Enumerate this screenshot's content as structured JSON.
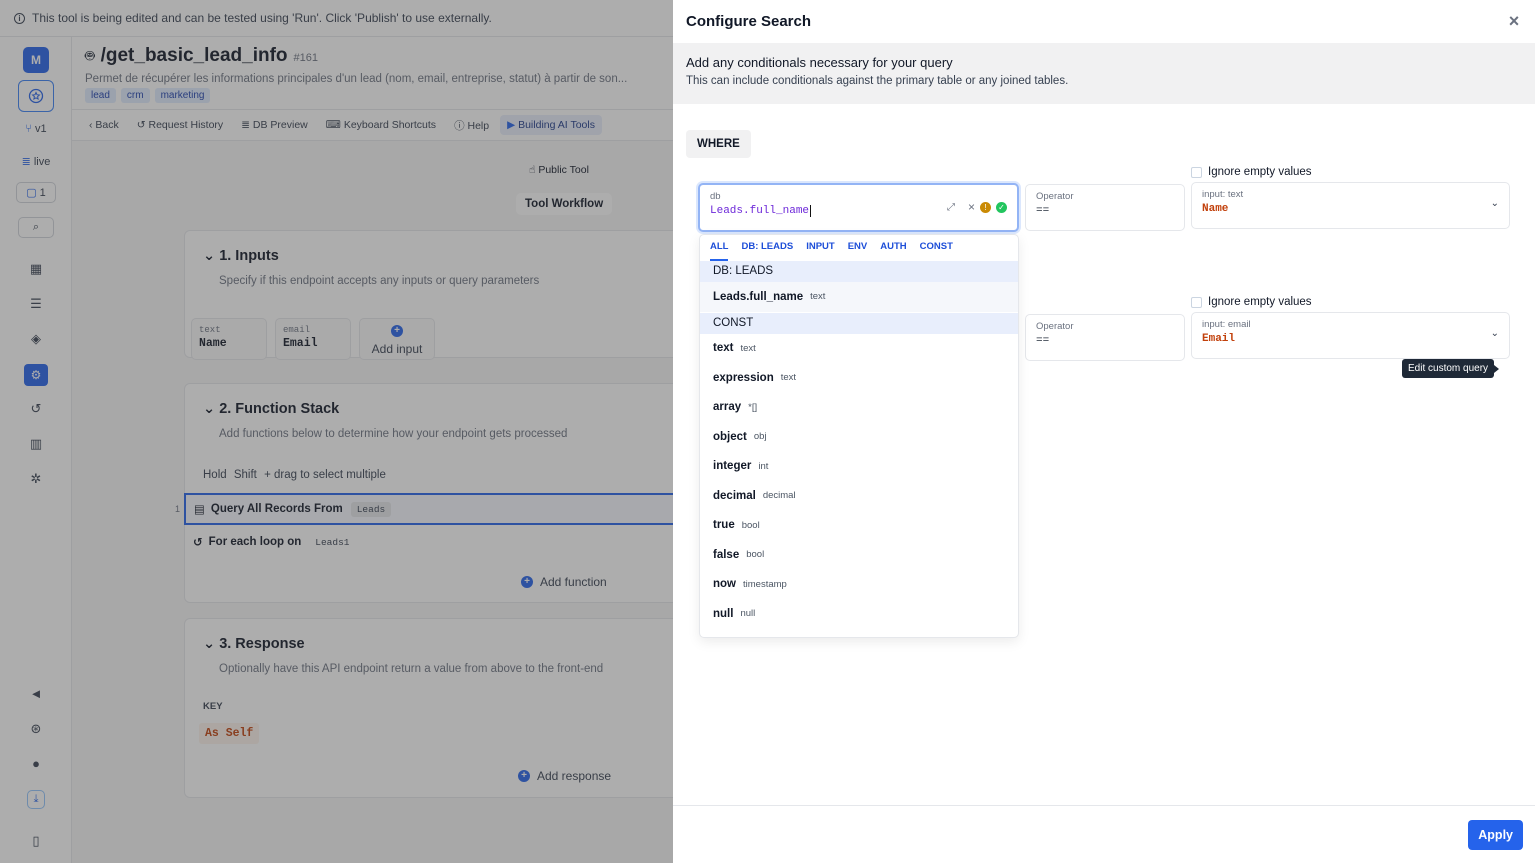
{
  "banner": {
    "text": "This tool is being edited and can be tested using 'Run'. Click 'Publish' to use externally."
  },
  "rail": {
    "avatar": "M",
    "version": "v1",
    "env": "live",
    "comments": "1"
  },
  "header": {
    "title": "/get_basic_lead_info",
    "number": "#161",
    "description": "Permet de récupérer les informations principales d'un lead (nom, email, entreprise, statut) à partir de son...",
    "tags": [
      "lead",
      "crm",
      "marketing"
    ]
  },
  "toolbar": {
    "back": "Back",
    "history": "Request History",
    "db_preview": "DB Preview",
    "shortcuts": "Keyboard Shortcuts",
    "help": "Help",
    "building": "Building AI Tools"
  },
  "canvas": {
    "public_tool": "Public Tool",
    "workflow": "Tool Workflow",
    "inputs": {
      "title": "1. Inputs",
      "subtitle": "Specify if this endpoint accepts any inputs or query parameters",
      "items": [
        {
          "type": "text",
          "name": "Name"
        },
        {
          "type": "email",
          "name": "Email"
        }
      ],
      "add": "Add input"
    },
    "function_stack": {
      "title": "2. Function Stack",
      "subtitle": "Add functions below to determine how your endpoint gets processed",
      "hint_hold": "Hold",
      "hint_key": "Shift",
      "hint_rest": "+ drag to select multiple",
      "row1_index": "1",
      "row1": "Query All Records From",
      "row1_tag": "Leads",
      "row2": "For each loop on",
      "row2_tag": "Leads1",
      "add": "Add function"
    },
    "response": {
      "title": "3. Response",
      "subtitle": "Optionally have this API endpoint return a value from above to the front-end",
      "key_label": "KEY",
      "key_value": "As Self",
      "add": "Add response"
    }
  },
  "modal": {
    "title": "Configure Search",
    "info_title": "Add any conditionals necessary for your query",
    "info_sub": "This can include conditionals against the primary table or any joined tables.",
    "where": "WHERE",
    "cond1": {
      "ignore": "Ignore empty values",
      "left_label": "db",
      "left_value": "Leads.full_name",
      "op_label": "Operator",
      "op_value": "==",
      "right_label": "input: text",
      "right_value": "Name"
    },
    "cond2": {
      "ignore": "Ignore empty values",
      "op_label": "Operator",
      "op_value": "==",
      "right_label": "input: email",
      "right_value": "Email"
    },
    "tooltip": "Edit custom query",
    "dropdown": {
      "tabs": [
        "ALL",
        "DB: LEADS",
        "INPUT",
        "ENV",
        "AUTH",
        "CONST"
      ],
      "section_db": "DB: LEADS",
      "db_items": [
        {
          "name": "Leads.full_name",
          "type": "text"
        }
      ],
      "section_const": "CONST",
      "const_items": [
        {
          "name": "text",
          "type": "text"
        },
        {
          "name": "expression",
          "type": "text"
        },
        {
          "name": "array",
          "type": "*[]"
        },
        {
          "name": "object",
          "type": "obj"
        },
        {
          "name": "integer",
          "type": "int"
        },
        {
          "name": "decimal",
          "type": "decimal"
        },
        {
          "name": "true",
          "type": "bool"
        },
        {
          "name": "false",
          "type": "bool"
        },
        {
          "name": "now",
          "type": "timestamp"
        },
        {
          "name": "null",
          "type": "null"
        }
      ]
    },
    "apply": "Apply"
  },
  "colors": {
    "accent": "#2563eb",
    "orange_value": "#c2410c",
    "purple_value": "#6d28d9"
  }
}
